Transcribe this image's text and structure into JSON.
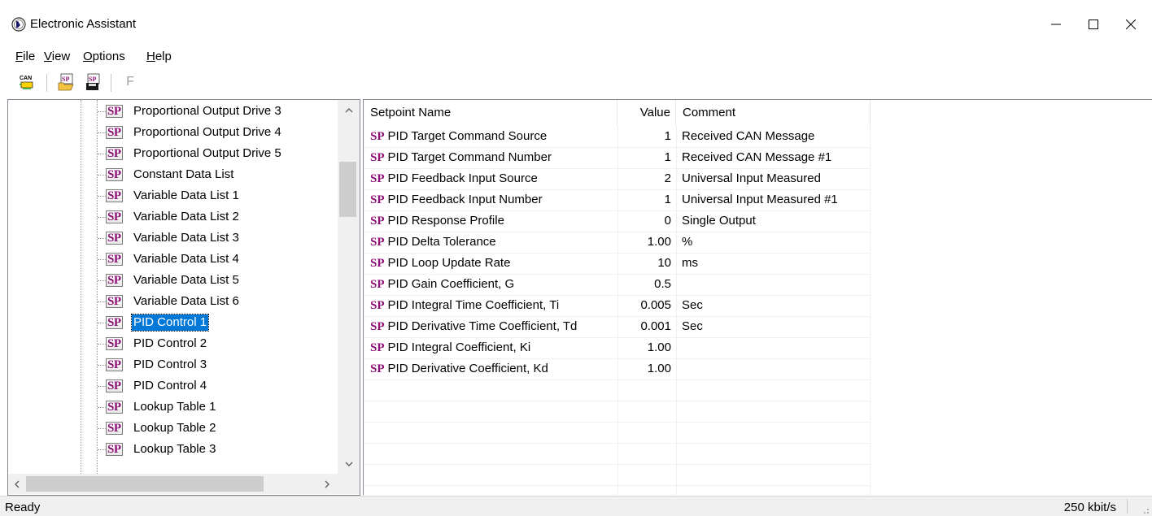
{
  "window": {
    "title": "Electronic Assistant",
    "controls": {
      "minimize": "—",
      "maximize": "☐",
      "close": "✕"
    }
  },
  "menu": [
    {
      "label": "File"
    },
    {
      "label": "View"
    },
    {
      "label": "Options"
    },
    {
      "label": "Help"
    }
  ],
  "toolbar": {
    "can_label": "CAN",
    "sp_label": "SP",
    "f_label": "F"
  },
  "tree": {
    "items": [
      {
        "label": "Proportional Output Drive 3"
      },
      {
        "label": "Proportional Output Drive 4"
      },
      {
        "label": "Proportional Output Drive 5"
      },
      {
        "label": "Constant Data List"
      },
      {
        "label": "Variable Data List 1"
      },
      {
        "label": "Variable Data List 2"
      },
      {
        "label": "Variable Data List 3"
      },
      {
        "label": "Variable Data List 4"
      },
      {
        "label": "Variable Data List 5"
      },
      {
        "label": "Variable Data List 6"
      },
      {
        "label": "PID Control 1",
        "selected": true
      },
      {
        "label": "PID Control 2"
      },
      {
        "label": "PID Control 3"
      },
      {
        "label": "PID Control 4"
      },
      {
        "label": "Lookup Table 1"
      },
      {
        "label": "Lookup Table 2"
      },
      {
        "label": "Lookup Table 3"
      }
    ],
    "icon_text": "SP"
  },
  "table": {
    "columns": [
      "Setpoint Name",
      "Value",
      "Comment"
    ],
    "row_icon_text": "SP",
    "rows": [
      {
        "name": "PID Target Command Source",
        "value": "1",
        "comment": "Received CAN Message"
      },
      {
        "name": "PID Target Command Number",
        "value": "1",
        "comment": "Received CAN Message #1"
      },
      {
        "name": "PID Feedback Input Source",
        "value": "2",
        "comment": "Universal Input Measured"
      },
      {
        "name": "PID Feedback Input Number",
        "value": "1",
        "comment": "Universal Input Measured #1"
      },
      {
        "name": "PID Response Profile",
        "value": "0",
        "comment": "Single Output"
      },
      {
        "name": "PID Delta Tolerance",
        "value": "1.00",
        "comment": "%"
      },
      {
        "name": "PID Loop Update Rate",
        "value": "10",
        "comment": "ms"
      },
      {
        "name": "PID Gain Coefficient, G",
        "value": "0.5",
        "comment": ""
      },
      {
        "name": "PID Integral Time Coefficient, Ti",
        "value": "0.005",
        "comment": "Sec"
      },
      {
        "name": "PID Derivative Time Coefficient, Td",
        "value": "0.001",
        "comment": "Sec"
      },
      {
        "name": "PID Integral Coefficient, Ki",
        "value": "1.00",
        "comment": ""
      },
      {
        "name": "PID Derivative Coefficient, Kd",
        "value": "1.00",
        "comment": ""
      }
    ]
  },
  "status": {
    "left": "Ready",
    "right": "250 kbit/s"
  },
  "colors": {
    "sp_icon": "#8b0f74",
    "selection": "#0078d7"
  }
}
